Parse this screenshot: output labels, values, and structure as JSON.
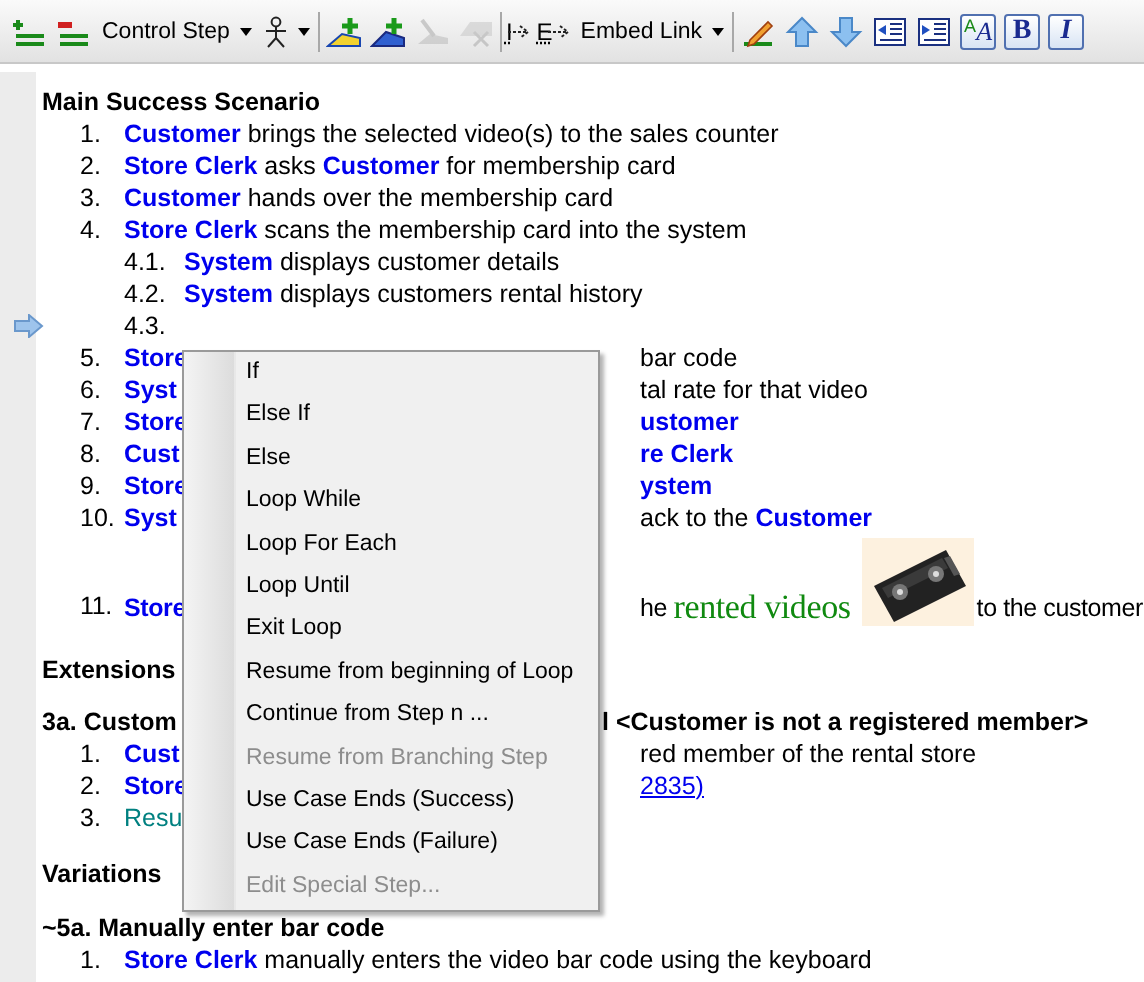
{
  "toolbar": [
    {
      "kind": "add-step",
      "disabled": false
    },
    {
      "kind": "remove-step",
      "disabled": false
    },
    {
      "kind": "dropdown",
      "label": "Control Step"
    },
    {
      "kind": "actor-dropdown"
    },
    {
      "kind": "separator"
    },
    {
      "kind": "add-yellow",
      "disabled": false
    },
    {
      "kind": "add-blue",
      "disabled": false
    },
    {
      "kind": "gray-a",
      "disabled": true
    },
    {
      "kind": "gray-b",
      "disabled": true
    },
    {
      "kind": "separator"
    },
    {
      "kind": "letter-arrow",
      "label": "I",
      "disabled": false
    },
    {
      "kind": "letter-arrow",
      "label": "E",
      "disabled": false
    },
    {
      "kind": "dropdown",
      "label": "Embed Link"
    },
    {
      "kind": "separator"
    },
    {
      "kind": "pencil",
      "disabled": false
    },
    {
      "kind": "up",
      "disabled": false
    },
    {
      "kind": "down",
      "disabled": false
    },
    {
      "kind": "outdent",
      "disabled": false
    },
    {
      "kind": "indent",
      "disabled": false
    },
    {
      "kind": "font",
      "label": "A",
      "label2": "A",
      "disabled": false
    },
    {
      "kind": "bold",
      "label": "B",
      "disabled": false
    },
    {
      "kind": "italic",
      "label": "I",
      "disabled": false
    }
  ],
  "main": {
    "heading": "Main Success Scenario",
    "steps": [
      {
        "number": "1.",
        "current": false,
        "segments": [
          {
            "kind": "actor",
            "text": "Customer"
          },
          {
            "kind": "text",
            "text": " brings the selected video(s) to the sales counter"
          }
        ]
      },
      {
        "number": "2.",
        "current": false,
        "segments": [
          {
            "kind": "actor",
            "text": "Store Clerk"
          },
          {
            "kind": "text",
            "text": " asks "
          },
          {
            "kind": "actor",
            "text": "Customer"
          },
          {
            "kind": "text",
            "text": " for membership card"
          }
        ]
      },
      {
        "number": "3.",
        "current": false,
        "segments": [
          {
            "kind": "actor",
            "text": "Customer"
          },
          {
            "kind": "text",
            "text": " hands over the membership card"
          }
        ]
      },
      {
        "number": "4.",
        "current": false,
        "segments": [
          {
            "kind": "actor",
            "text": "Store Clerk"
          },
          {
            "kind": "text",
            "text": " scans the membership card into the system"
          }
        ],
        "children": [
          {
            "number": "4.1.",
            "current": false,
            "segments": [
              {
                "kind": "actor",
                "text": "System"
              },
              {
                "kind": "text",
                "text": " displays customer details"
              }
            ]
          },
          {
            "number": "4.2.",
            "current": false,
            "segments": [
              {
                "kind": "actor",
                "text": "System"
              },
              {
                "kind": "text",
                "text": " displays customers rental history"
              }
            ]
          },
          {
            "number": "4.3.",
            "current": true
          }
        ]
      },
      {
        "number": "5.",
        "current": false,
        "segments": [
          {
            "kind": "actor",
            "text": "Store"
          }
        ],
        "after_menu": [
          {
            "kind": "text",
            "text": "bar code"
          }
        ]
      },
      {
        "number": "6.",
        "current": false,
        "segments": [
          {
            "kind": "actor",
            "text": "Syst"
          }
        ],
        "after_menu": [
          {
            "kind": "text",
            "text": "tal rate for that video"
          }
        ]
      },
      {
        "number": "7.",
        "current": false,
        "segments": [
          {
            "kind": "actor",
            "text": "Store"
          }
        ],
        "after_menu": [
          {
            "kind": "actor",
            "text": "ustomer"
          }
        ]
      },
      {
        "number": "8.",
        "current": false,
        "segments": [
          {
            "kind": "actor",
            "text": "Cust"
          }
        ],
        "after_menu": [
          {
            "kind": "actor",
            "text": "re Clerk"
          }
        ]
      },
      {
        "number": "9.",
        "current": false,
        "segments": [
          {
            "kind": "actor",
            "text": "Store"
          }
        ],
        "after_menu": [
          {
            "kind": "actor",
            "text": "ystem"
          }
        ]
      },
      {
        "number": "10.",
        "current": false,
        "segments": [
          {
            "kind": "actor",
            "text": "Syst"
          }
        ],
        "after_menu": [
          {
            "kind": "text",
            "text": "ack to the "
          },
          {
            "kind": "actor",
            "text": "Customer"
          }
        ]
      },
      {
        "number": "11.",
        "current": false,
        "segments": [
          {
            "kind": "actor",
            "text": "Store"
          }
        ],
        "after_menu": [
          {
            "kind": "text",
            "text": "he "
          },
          {
            "kind": "object",
            "text": "rented videos"
          },
          {
            "kind": "picture"
          },
          {
            "kind": "text",
            "text": "to the customer"
          }
        ]
      }
    ]
  },
  "extensions": {
    "heading": "Extensions",
    "items": [
      {
        "title": "3a. Custom",
        "title_after_menu": "l <Customer is not a registered member>",
        "steps": [
          {
            "number": "1.",
            "segments": [
              {
                "kind": "actor",
                "text": "Cust"
              }
            ],
            "after_menu": [
              {
                "kind": "text",
                "text": "red member of the rental store"
              }
            ]
          },
          {
            "number": "2.",
            "segments": [
              {
                "kind": "actor",
                "text": "Store"
              }
            ],
            "after_menu": [
              {
                "kind": "link",
                "text": "2835)"
              }
            ]
          },
          {
            "number": "3.",
            "segments": [
              {
                "kind": "resume",
                "text": "Resu"
              }
            ]
          }
        ]
      }
    ]
  },
  "variations": {
    "heading": "Variations",
    "items": [
      {
        "title": "~5a. Manually enter bar code",
        "steps": [
          {
            "number": "1.",
            "segments": [
              {
                "kind": "actor",
                "text": "Store Clerk"
              },
              {
                "kind": "text",
                "text": " manually enters the video bar code using the keyboard"
              }
            ]
          }
        ]
      }
    ]
  },
  "context_menu": [
    {
      "label": "If",
      "disabled": false
    },
    {
      "label": "Else If",
      "disabled": false
    },
    {
      "label": "Else",
      "disabled": false
    },
    {
      "label": "Loop While",
      "disabled": false
    },
    {
      "label": "Loop For Each",
      "disabled": false
    },
    {
      "label": "Loop Until",
      "disabled": false
    },
    {
      "label": "Exit Loop",
      "disabled": false
    },
    {
      "label": "Resume from beginning of Loop",
      "disabled": false
    },
    {
      "label": "Continue from Step n ...",
      "disabled": false
    },
    {
      "label": "Resume from Branching Step",
      "disabled": true
    },
    {
      "label": "Use Case Ends (Success)",
      "disabled": false
    },
    {
      "label": "Use Case Ends (Failure)",
      "disabled": false
    },
    {
      "label": "Edit Special Step...",
      "disabled": true
    }
  ]
}
